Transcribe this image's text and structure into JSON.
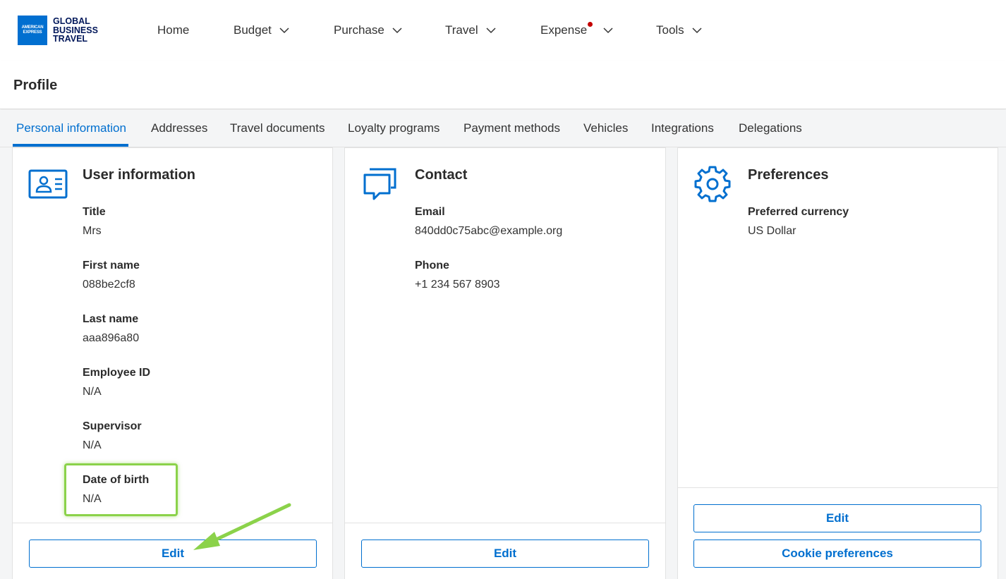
{
  "brand": {
    "logo_mark": "AMERICAN EXPRESS",
    "logo_line1": "GLOBAL",
    "logo_line2": "BUSINESS",
    "logo_line3": "TRAVEL",
    "color": "#016fd0"
  },
  "nav": {
    "items": [
      {
        "label": "Home",
        "has_dropdown": false
      },
      {
        "label": "Budget",
        "has_dropdown": true
      },
      {
        "label": "Purchase",
        "has_dropdown": true
      },
      {
        "label": "Travel",
        "has_dropdown": true
      },
      {
        "label": "Expense",
        "has_dropdown": true,
        "notification_dot": true
      },
      {
        "label": "Tools",
        "has_dropdown": true
      }
    ],
    "notification_color": "#c40000"
  },
  "page": {
    "title": "Profile"
  },
  "tabs": [
    {
      "label": "Personal information",
      "active": true
    },
    {
      "label": "Addresses"
    },
    {
      "label": "Travel documents"
    },
    {
      "label": "Loyalty programs"
    },
    {
      "label": "Payment methods"
    },
    {
      "label": "Vehicles"
    },
    {
      "label": "Integrations"
    },
    {
      "label": "Delegations"
    }
  ],
  "accent_color": "#006fcf",
  "cards": {
    "user_info": {
      "title": "User information",
      "icon": "id-card-icon",
      "fields": [
        {
          "label": "Title",
          "value": "Mrs"
        },
        {
          "label": "First name",
          "value": "088be2cf8"
        },
        {
          "label": "Last name",
          "value": "aaa896a80"
        },
        {
          "label": "Employee ID",
          "value": "N/A"
        },
        {
          "label": "Supervisor",
          "value": "N/A"
        },
        {
          "label": "Date of birth",
          "value": "N/A"
        }
      ],
      "edit_label": "Edit"
    },
    "contact": {
      "title": "Contact",
      "icon": "chat-bubbles-icon",
      "fields": [
        {
          "label": "Email",
          "value": "840dd0c75abc@example.org"
        },
        {
          "label": "Phone",
          "value": "+1 234 567 8903"
        }
      ],
      "edit_label": "Edit"
    },
    "preferences": {
      "title": "Preferences",
      "icon": "gear-icon",
      "fields": [
        {
          "label": "Preferred currency",
          "value": "US Dollar"
        }
      ],
      "edit_label": "Edit",
      "cookie_label": "Cookie preferences"
    }
  },
  "annotation": {
    "highlight_color": "#8bd24a",
    "highlight_target": "Date of birth",
    "arrow_target": "Edit"
  }
}
